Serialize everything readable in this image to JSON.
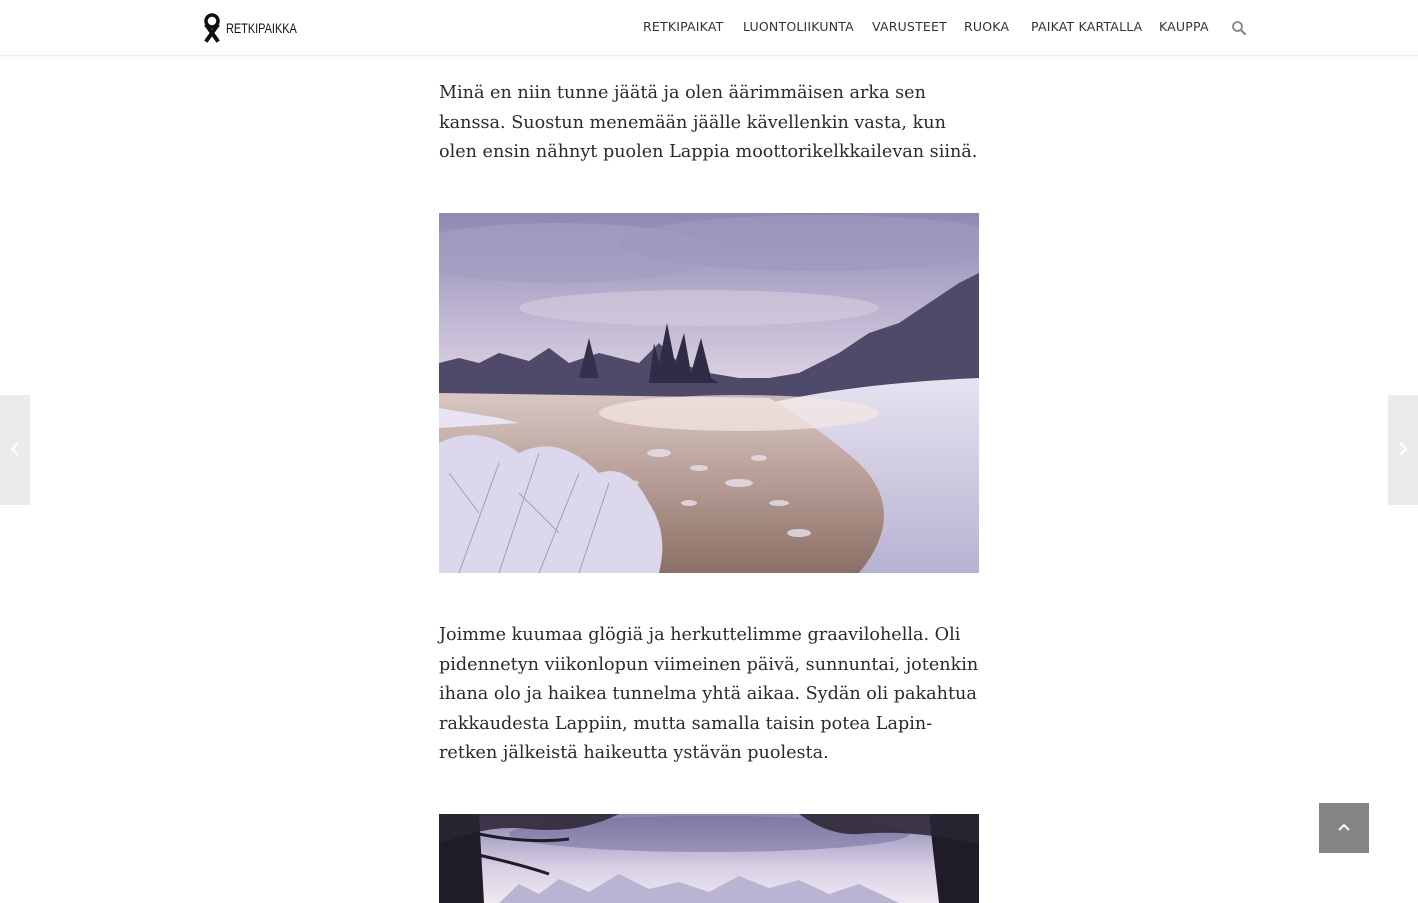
{
  "site": {
    "logo_text": "RETKIPAIKKA"
  },
  "nav": {
    "items": [
      {
        "label": "RETKIPAIKAT"
      },
      {
        "label": "LUONTOLIIKUNTA"
      },
      {
        "label": "VARUSTEET"
      },
      {
        "label": "RUOKA"
      },
      {
        "label": "PAIKAT KARTALLA"
      },
      {
        "label": "KAUPPA"
      }
    ],
    "search_icon": "search-icon"
  },
  "article": {
    "paragraph_1": "Minä en niin tunne jäätä ja olen äärimmäisen arka sen kanssa. Suostun menemään jäälle kävellenkin vasta, kun olen ensin nähnyt puolen Lappia moottorikelkkailevan siinä.",
    "paragraph_2": "Joimme kuumaa glögiä ja herkuttelimme graavilohella. Oli pidennetyn viikonlopun viimeinen päivä, sunnuntai, jotenkin ihana olo ja haikea tunnelma yhtä aikaa. Sydän oli pakahtua rakkaudesta Lappiin, mutta samalla taisin potea Lapin-retken jälkeistä haikeutta ystävän puolesta."
  },
  "controls": {
    "prev_icon": "chevron-left-icon",
    "next_icon": "chevron-right-icon",
    "scroll_top_icon": "chevron-up-icon"
  },
  "colors": {
    "header_bg": "#ffffff",
    "text": "#2a2a2a",
    "nav_text": "#333333",
    "side_arrow_bg": "#ebebeb",
    "scroll_top_bg": "#858585"
  }
}
